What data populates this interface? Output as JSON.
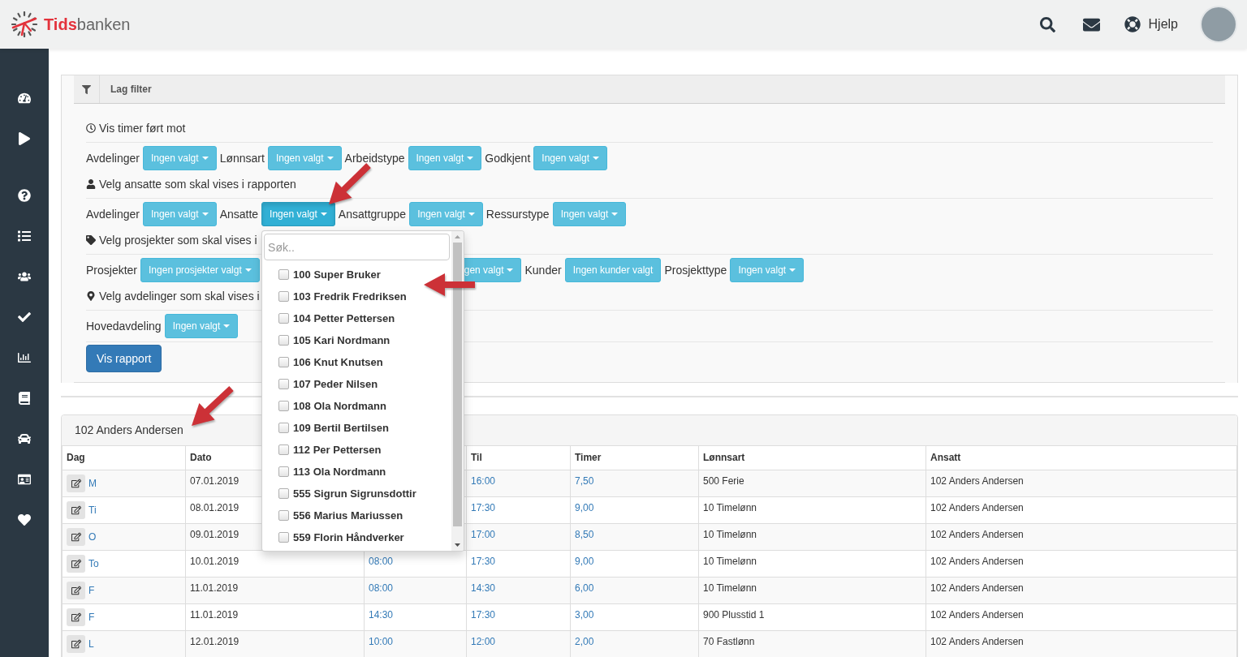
{
  "header": {
    "logo": {
      "accent": "Tids",
      "rest": "banken"
    },
    "help": "Hjelp"
  },
  "filter_panel": {
    "title": "Lag filter",
    "sections": [
      {
        "heading": "Vis timer ført mot",
        "fields": [
          {
            "kind": "dropdown",
            "label": "Avdelinger",
            "button": "Ingen valgt",
            "expanded": false
          },
          {
            "kind": "dropdown",
            "label": "Lønnsart",
            "button": "Ingen valgt",
            "expanded": false
          },
          {
            "kind": "dropdown",
            "label": "Arbeidstype",
            "button": "Ingen valgt",
            "expanded": false
          },
          {
            "kind": "dropdown",
            "label": "Godkjent",
            "button": "Ingen valgt",
            "expanded": false
          }
        ]
      },
      {
        "heading": "Velg ansatte som skal vises i rapporten",
        "fields": [
          {
            "kind": "dropdown",
            "label": "Avdelinger",
            "button": "Ingen valgt",
            "expanded": false
          },
          {
            "kind": "dropdown",
            "label": "Ansatte",
            "button": "Ingen valgt",
            "expanded": true,
            "menu": {
              "search": {
                "placeholder": "Søk.."
              },
              "options": [
                {
                  "label": "100 Super Bruker",
                  "checked": false
                },
                {
                  "label": "103 Fredrik Fredriksen",
                  "checked": false
                },
                {
                  "label": "104 Petter Pettersen",
                  "checked": false
                },
                {
                  "label": "105 Kari Nordmann",
                  "checked": false
                },
                {
                  "label": "106 Knut Knutsen",
                  "checked": false
                },
                {
                  "label": "107 Peder Nilsen",
                  "checked": false
                },
                {
                  "label": "108 Ola Nordmann",
                  "checked": false
                },
                {
                  "label": "109 Bertil Bertilsen",
                  "checked": false
                },
                {
                  "label": "112 Per Pettersen",
                  "checked": false
                },
                {
                  "label": "113 Ola Nordmann",
                  "checked": false
                },
                {
                  "label": "555 Sigrun Sigrunsdottir",
                  "checked": false
                },
                {
                  "label": "556 Marius Mariussen",
                  "checked": false
                },
                {
                  "label": "559 Florin Håndverker",
                  "checked": false
                }
              ]
            }
          },
          {
            "kind": "dropdown",
            "label": "Ansattgruppe",
            "button": "Ingen valgt",
            "expanded": false
          },
          {
            "kind": "dropdown",
            "label": "Ressurstype",
            "button": "Ingen valgt",
            "expanded": false
          }
        ]
      },
      {
        "heading": "Velg prosjekter som skal vises i",
        "fields": [
          {
            "kind": "dropdown",
            "label": "Prosjekter",
            "button": "Ingen prosjekter valgt",
            "expanded": false
          },
          {
            "kind": "covered",
            "button": "gen valgt",
            "expanded": false
          },
          {
            "kind": "button",
            "label": "Kunder",
            "button": "Ingen kunder valgt",
            "expanded": false
          },
          {
            "kind": "dropdown",
            "label": "Prosjekttype",
            "button": "Ingen valgt",
            "expanded": false
          }
        ]
      },
      {
        "heading": "Velg avdelinger som skal vises i",
        "fields": [
          {
            "kind": "dropdown",
            "label": "Hovedavdeling",
            "button": "Ingen valgt",
            "expanded": false
          }
        ]
      }
    ],
    "submit": "Vis rapport"
  },
  "report": {
    "title": "102 Anders Andersen",
    "columns": [
      "Dag",
      "Dato",
      null,
      "Til",
      "Timer",
      "Lønnsart",
      "Ansatt"
    ],
    "rows": [
      {
        "day": "M",
        "date": "07.01.2019",
        "to": "16:00",
        "hours": "7,50",
        "wage_type": "500 Ferie",
        "employee": "102 Anders Andersen"
      },
      {
        "day": "Ti",
        "date": "08.01.2019",
        "to": "17:30",
        "hours": "9,00",
        "wage_type": "10 Timelønn",
        "employee": "102 Anders Andersen"
      },
      {
        "day": "O",
        "date": "09.01.2019",
        "to": "17:00",
        "hours": "8,50",
        "wage_type": "10 Timelønn",
        "employee": "102 Anders Andersen"
      },
      {
        "day": "To",
        "date": "10.01.2019",
        "column_3": "08:00",
        "to": "17:30",
        "hours": "9,00",
        "wage_type": "10 Timelønn",
        "employee": "102 Anders Andersen"
      },
      {
        "day": "F",
        "date": "11.01.2019",
        "column_3": "08:00",
        "to": "14:30",
        "hours": "6,00",
        "wage_type": "10 Timelønn",
        "employee": "102 Anders Andersen"
      },
      {
        "day": "F",
        "date": "11.01.2019",
        "column_3": "14:30",
        "to": "17:30",
        "hours": "3,00",
        "wage_type": "900 Plusstid 1",
        "employee": "102 Anders Andersen"
      },
      {
        "day": "L",
        "date": "12.01.2019",
        "column_3": "10:00",
        "to": "12:00",
        "hours": "2,00",
        "wage_type": "70 Fastlønn",
        "employee": "102 Anders Andersen"
      }
    ]
  }
}
